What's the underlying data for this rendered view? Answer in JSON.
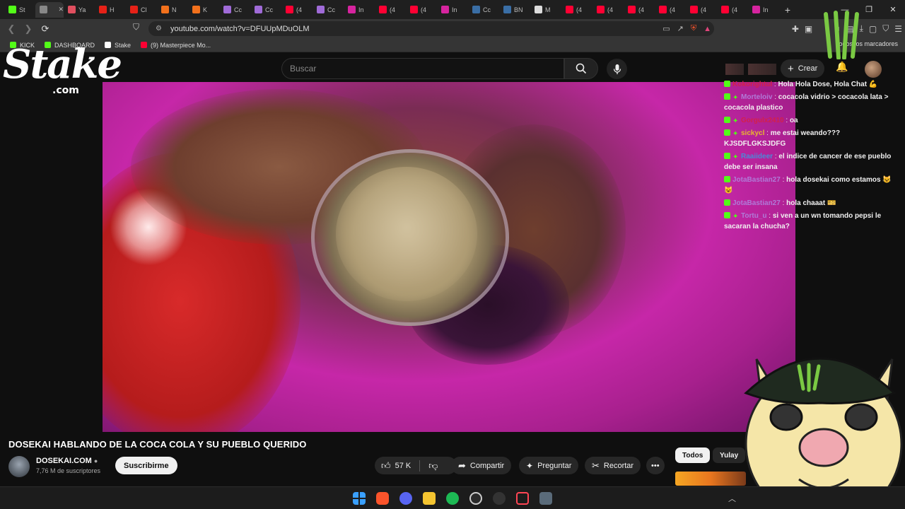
{
  "browser": {
    "tabs": [
      {
        "label": "St",
        "color": "#53fc18"
      },
      {
        "label": "",
        "color": "#888888",
        "active": true
      },
      {
        "label": "Ya",
        "color": "#e04f5f"
      },
      {
        "label": "H",
        "color": "#e62117"
      },
      {
        "label": "Cl",
        "color": "#e62117"
      },
      {
        "label": "N",
        "color": "#f2711c"
      },
      {
        "label": "K",
        "color": "#f2711c"
      },
      {
        "label": "Cc",
        "color": "#a06bd8"
      },
      {
        "label": "Cc",
        "color": "#a06bd8"
      },
      {
        "label": "(4",
        "color": "#ff0033"
      },
      {
        "label": "Cc",
        "color": "#a06bd8"
      },
      {
        "label": "In",
        "color": "#d6249f"
      },
      {
        "label": "(4",
        "color": "#ff0033"
      },
      {
        "label": "(4",
        "color": "#ff0033"
      },
      {
        "label": "In",
        "color": "#d6249f"
      },
      {
        "label": "Cc",
        "color": "#3a6ea5"
      },
      {
        "label": "BN",
        "color": "#3a6ea5"
      },
      {
        "label": "M",
        "color": "#dddddd"
      },
      {
        "label": "(4",
        "color": "#ff0033"
      },
      {
        "label": "(4",
        "color": "#ff0033"
      },
      {
        "label": "(4",
        "color": "#ff0033"
      },
      {
        "label": "(4",
        "color": "#ff0033"
      },
      {
        "label": "(4",
        "color": "#ff0033"
      },
      {
        "label": "(4",
        "color": "#ff0033"
      },
      {
        "label": "In",
        "color": "#d6249f"
      }
    ],
    "new_tab": "+",
    "url": "youtube.com/watch?v=DFUUpMDuOLM",
    "bookmarks": [
      {
        "label": "KICK",
        "color": "#53fc18"
      },
      {
        "label": "DASHBOARD",
        "color": "#53fc18"
      },
      {
        "label": "Stake",
        "color": "#ffffff"
      },
      {
        "label": "(9) Masterpiece Mo...",
        "color": "#ff0033"
      }
    ],
    "all_bookmarks": "Todos los marcadores"
  },
  "youtube": {
    "search_placeholder": "Buscar",
    "create_label": "Crear",
    "video_title": "DOSEKAI HABLANDO DE LA COCA COLA Y SU PUEBLO QUERIDO",
    "channel_name": "DOSEKAI.COM",
    "subscribers": "7,76 M de suscriptores",
    "subscribe_label": "Suscribirme",
    "likes": "57 K",
    "share_label": "Compartir",
    "ask_label": "Preguntar",
    "clip_label": "Recortar",
    "more_label": "•••",
    "chips": [
      "Todos",
      "Yulay"
    ]
  },
  "overlay": {
    "stake_word": "Stake",
    "stake_com": ".com",
    "chat": [
      {
        "user": "Kokorightul",
        "user_color": "#d4204a",
        "text": "Hola Hola Dose, Hola Chat 💪",
        "badges": 1
      },
      {
        "user": "Morteloiv",
        "user_color": "#b07ad8",
        "text": "cocacola vidrio > cocacola lata > cocacola plastico",
        "badges": 2
      },
      {
        "user": "Gorgulx2410",
        "user_color": "#d4204a",
        "text": "oa",
        "badges": 2
      },
      {
        "user": "sickycl",
        "user_color": "#e8b830",
        "text": "me estai weando??? KJSDFLGKSJDFG",
        "badges": 2
      },
      {
        "user": "Raaiideer",
        "user_color": "#4a8ad8",
        "text": "el indice de cancer de ese pueblo debe ser insana",
        "badges": 2
      },
      {
        "user": "JotaBastian27",
        "user_color": "#b07ad8",
        "text": "hola dosekai como estamos 😺 😺",
        "badges": 1
      },
      {
        "user": "JotaBastian27",
        "user_color": "#b07ad8",
        "text": "hola chaaat 🎫",
        "badges": 1
      },
      {
        "user": "Tortu_u",
        "user_color": "#b07ad8",
        "text": "si ven a un wn tomando pepsi le sacaran la chucha?",
        "badges": 2
      }
    ]
  },
  "colors": {
    "kick_green": "#53fc18",
    "yt_bg": "#0f0f0f",
    "accent_magenta": "#c627a8"
  },
  "taskbar": {
    "icons": [
      "windows-start-icon",
      "brave-icon",
      "discord-icon",
      "file-explorer-icon",
      "spotify-icon",
      "steam-icon",
      "app-icon",
      "valorant-icon",
      "calculator-icon"
    ]
  }
}
